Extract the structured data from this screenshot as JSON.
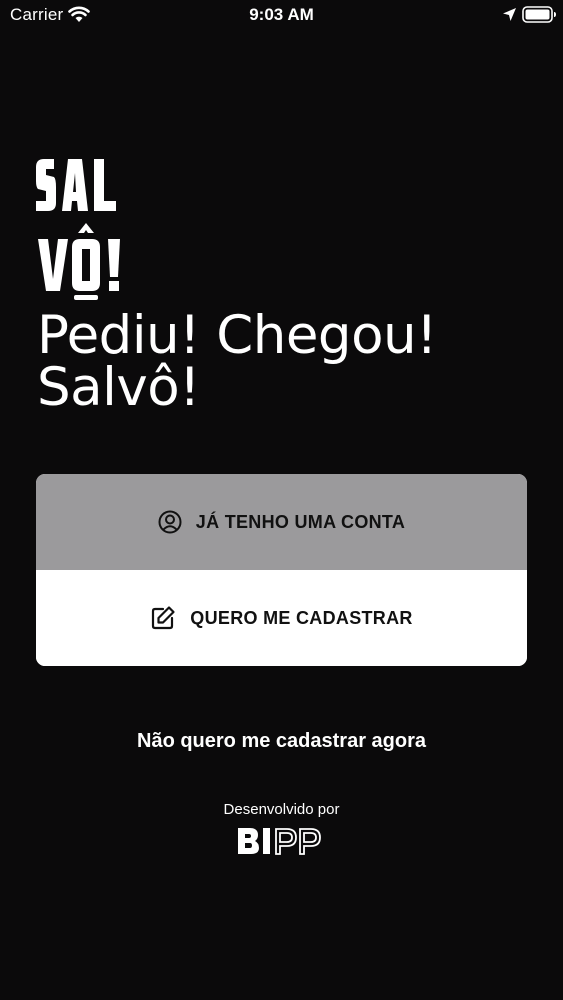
{
  "status_bar": {
    "carrier": "Carrier",
    "time": "9:03 AM"
  },
  "logo": {
    "line1": "SAL",
    "line2": "VÔ!"
  },
  "tagline": {
    "line1": "Pediu! Chegou!",
    "line2": "Salvô!"
  },
  "buttons": {
    "login_label": "JÁ TENHO UMA CONTA",
    "signup_label": "QUERO ME CADASTRAR"
  },
  "skip_link": "Não quero me cadastrar agora",
  "footer": {
    "developed_by": "Desenvolvido por",
    "developer_logo": "BIPP"
  },
  "colors": {
    "background": "#0b0a0b",
    "login_button": "#9b9a9c",
    "signup_button": "#ffffff",
    "text": "#ffffff"
  },
  "icons": {
    "login": "user-circle-icon",
    "signup": "edit-icon"
  }
}
